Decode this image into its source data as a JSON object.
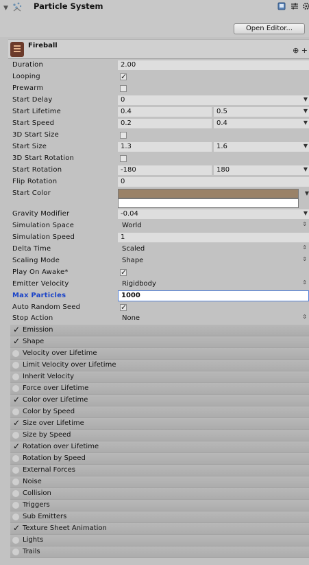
{
  "component": {
    "title": "Particle System",
    "open_editor": "Open Editor..."
  },
  "main_module": {
    "name": "Fireball"
  },
  "props": {
    "duration": {
      "label": "Duration",
      "value": "2.00"
    },
    "looping": {
      "label": "Looping",
      "checked": true
    },
    "prewarm": {
      "label": "Prewarm",
      "checked": false
    },
    "start_delay": {
      "label": "Start Delay",
      "value": "0"
    },
    "start_lifetime": {
      "label": "Start Lifetime",
      "min": "0.4",
      "max": "0.5"
    },
    "start_speed": {
      "label": "Start Speed",
      "min": "0.2",
      "max": "0.4"
    },
    "size3d": {
      "label": "3D Start Size",
      "checked": false
    },
    "start_size": {
      "label": "Start Size",
      "min": "1.3",
      "max": "1.6"
    },
    "rot3d": {
      "label": "3D Start Rotation",
      "checked": false
    },
    "start_rotation": {
      "label": "Start Rotation",
      "min": "-180",
      "max": "180"
    },
    "flip_rotation": {
      "label": "Flip Rotation",
      "value": "0"
    },
    "start_color": {
      "label": "Start Color",
      "color_a": "#9a8268",
      "color_b": "#ffffff"
    },
    "gravity": {
      "label": "Gravity Modifier",
      "value": "-0.04"
    },
    "sim_space": {
      "label": "Simulation Space",
      "value": "World"
    },
    "sim_speed": {
      "label": "Simulation Speed",
      "value": "1"
    },
    "delta_time": {
      "label": "Delta Time",
      "value": "Scaled"
    },
    "scaling_mode": {
      "label": "Scaling Mode",
      "value": "Shape"
    },
    "play_on_awake": {
      "label": "Play On Awake*",
      "checked": true
    },
    "emitter_velocity": {
      "label": "Emitter Velocity",
      "value": "Rigidbody"
    },
    "max_particles": {
      "label": "Max Particles",
      "value": "1000"
    },
    "auto_seed": {
      "label": "Auto Random Seed",
      "checked": true
    },
    "stop_action": {
      "label": "Stop Action",
      "value": "None"
    }
  },
  "modules": [
    {
      "label": "Emission",
      "enabled": true
    },
    {
      "label": "Shape",
      "enabled": true
    },
    {
      "label": "Velocity over Lifetime",
      "enabled": false
    },
    {
      "label": "Limit Velocity over Lifetime",
      "enabled": false
    },
    {
      "label": "Inherit Velocity",
      "enabled": false
    },
    {
      "label": "Force over Lifetime",
      "enabled": false
    },
    {
      "label": "Color over Lifetime",
      "enabled": true
    },
    {
      "label": "Color by Speed",
      "enabled": false
    },
    {
      "label": "Size over Lifetime",
      "enabled": true
    },
    {
      "label": "Size by Speed",
      "enabled": false
    },
    {
      "label": "Rotation over Lifetime",
      "enabled": true
    },
    {
      "label": "Rotation by Speed",
      "enabled": false
    },
    {
      "label": "External Forces",
      "enabled": false
    },
    {
      "label": "Noise",
      "enabled": false
    },
    {
      "label": "Collision",
      "enabled": false
    },
    {
      "label": "Triggers",
      "enabled": false
    },
    {
      "label": "Sub Emitters",
      "enabled": false
    },
    {
      "label": "Texture Sheet Animation",
      "enabled": true
    },
    {
      "label": "Lights",
      "enabled": false
    },
    {
      "label": "Trails",
      "enabled": false
    }
  ]
}
